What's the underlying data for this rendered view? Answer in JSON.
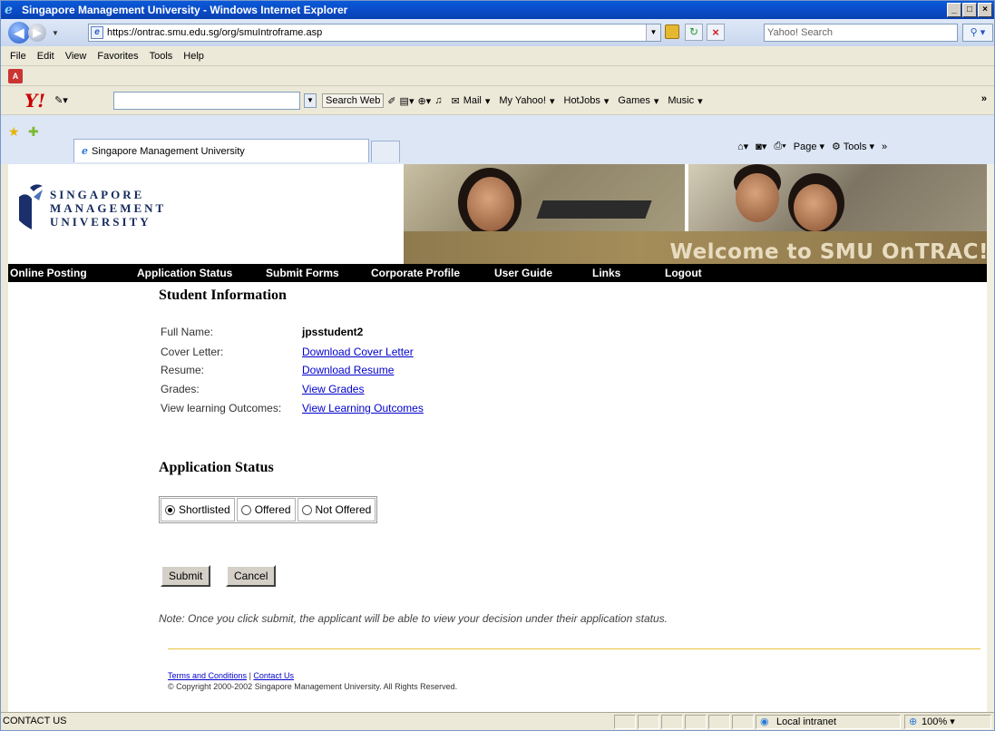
{
  "window": {
    "title": "Singapore Management University - Windows Internet Explorer"
  },
  "address": {
    "url": "https://ontrac.smu.edu.sg/org/smuIntroframe.asp",
    "search_placeholder": "Yahoo! Search"
  },
  "menu": [
    "File",
    "Edit",
    "View",
    "Favorites",
    "Tools",
    "Help"
  ],
  "yahoo_toolbar": {
    "search_web": "Search Web",
    "mail": "Mail",
    "my_yahoo": "My Yahoo!",
    "hotjobs": "HotJobs",
    "games": "Games",
    "music": "Music"
  },
  "tab": {
    "title": "Singapore Management University"
  },
  "right_tools": {
    "page": "Page",
    "tools": "Tools"
  },
  "banner": {
    "logo_line1": "SINGAPORE",
    "logo_line2": "MANAGEMENT",
    "logo_line3": "UNIVERSITY",
    "welcome": "Welcome to SMU OnTRAC!"
  },
  "nav": [
    "Online Posting",
    "Application Status",
    "Submit Forms",
    "Corporate Profile",
    "User Guide",
    "Links",
    "Logout"
  ],
  "student": {
    "heading": "Student Information",
    "rows": [
      {
        "label": "Full Name:",
        "value": "jpsstudent2"
      },
      {
        "label": "Cover Letter:",
        "value": "Download Cover Letter"
      },
      {
        "label": "Resume:",
        "value": "Download Resume"
      },
      {
        "label": "Grades:",
        "value": "View Grades"
      },
      {
        "label": "View learning Outcomes:",
        "value": "View Learning Outcomes"
      }
    ]
  },
  "status": {
    "heading": "Application Status",
    "options": [
      "Shortlisted",
      "Offered",
      "Not Offered"
    ],
    "selected": "Shortlisted"
  },
  "buttons": {
    "submit": "Submit",
    "cancel": "Cancel"
  },
  "note": "Note: Once you click submit, the applicant will be able to view your decision under their application status.",
  "footer": {
    "terms": "Terms and Conditions",
    "sep": "|",
    "contact": "Contact Us",
    "copyright": "© Copyright 2000-2002 Singapore Management University. All Rights Reserved."
  },
  "statusbar": {
    "left": "CONTACT US",
    "zone": "Local intranet",
    "zoom": "100%"
  }
}
